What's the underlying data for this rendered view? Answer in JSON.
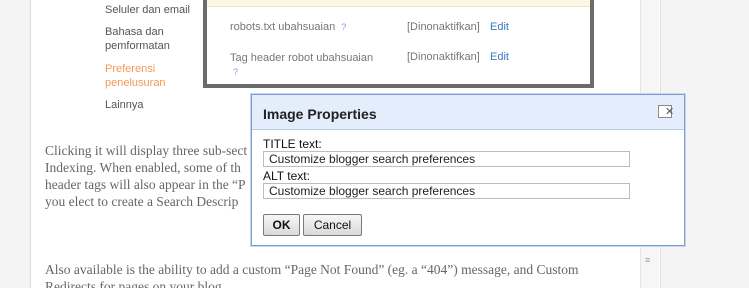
{
  "settings_menu": {
    "items": [
      {
        "label": "Seluler dan email"
      },
      {
        "label": "Bahasa dan pemformatan"
      },
      {
        "label": "Preferensi penelusuran",
        "active": true
      },
      {
        "label": "Lainnya"
      }
    ]
  },
  "crawler_panel": {
    "rows": [
      {
        "label": "robots.txt ubahsuaian",
        "help": "?",
        "status": "[Dinonaktifkan]",
        "action": "Edit"
      },
      {
        "label": "Tag header robot ubahsuaian",
        "help": "?",
        "status": "[Dinonaktifkan]",
        "action": "Edit"
      }
    ]
  },
  "article": {
    "line1": "Clicking it will display three sub-sect",
    "line2": "Indexing. When enabled, some of th",
    "line3": "header tags will also appear in the “P",
    "line4": "you elect to create a Search Descrip",
    "line5": "Also available is the ability to add a custom “Page Not Found” (eg. a “404”) message, and Custom",
    "line6": "Redirects for pages on your blog."
  },
  "dialog": {
    "title": "Image Properties",
    "close_symbol": "✕",
    "title_label": "TITLE text:",
    "title_value": "Customize blogger search preferences",
    "alt_label": "ALT text:",
    "alt_value": "Customize blogger search preferences",
    "ok_label": "OK",
    "cancel_label": "Cancel"
  },
  "colors": {
    "active_menu": "#f29a5a",
    "link": "#3b78c4",
    "dialog_header": "#e4edfb",
    "dialog_border": "#7b9ed1"
  }
}
